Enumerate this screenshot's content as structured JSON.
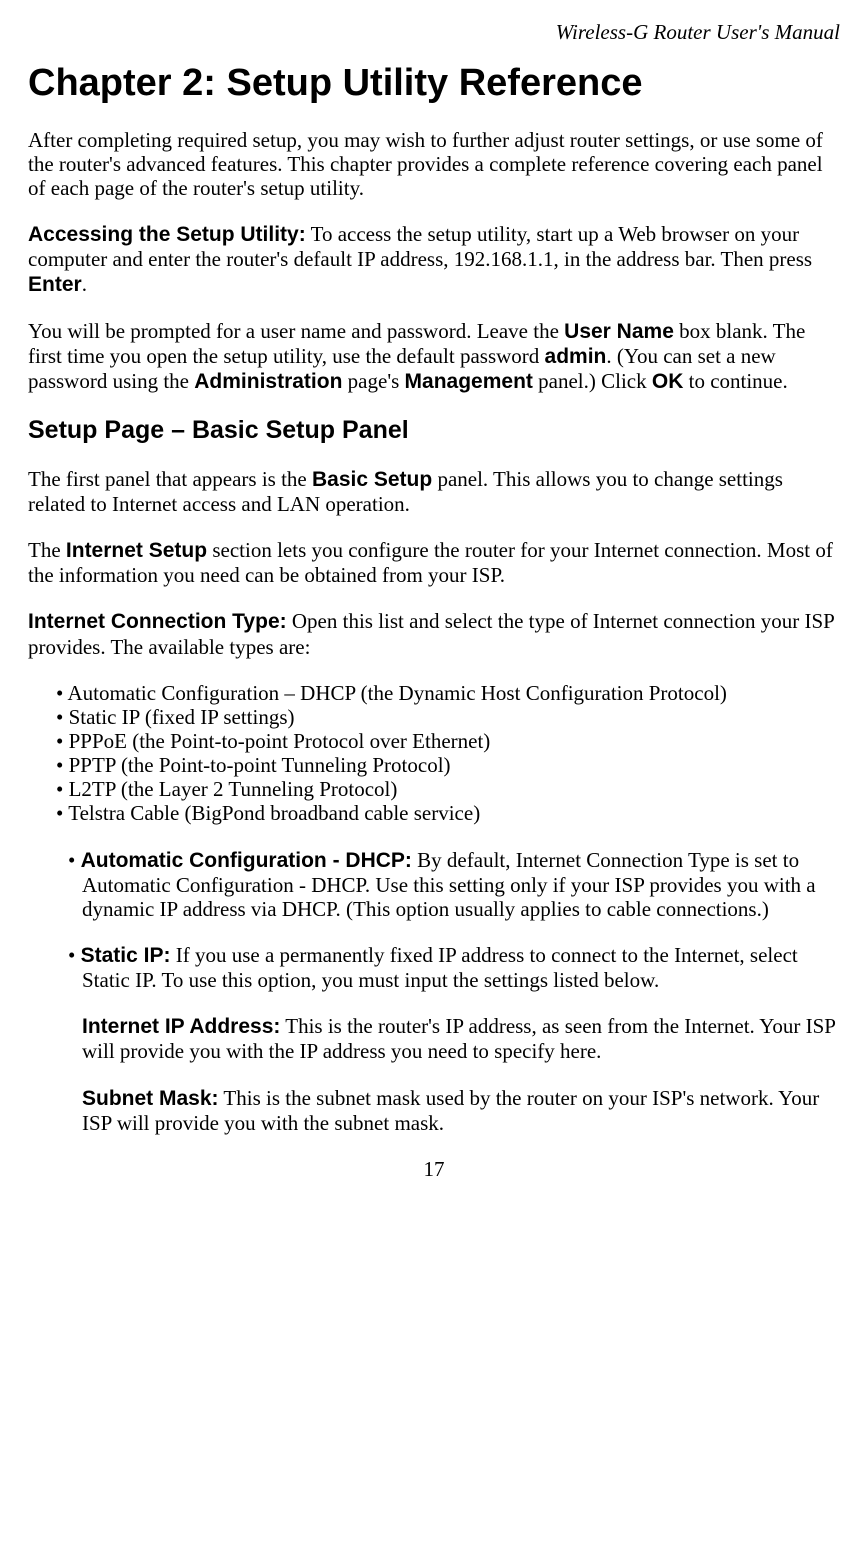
{
  "header": {
    "title": "Wireless-G Router User's Manual"
  },
  "chapter": {
    "title": "Chapter 2: Setup Utility Reference"
  },
  "intro": "After completing required setup, you may wish to further adjust router settings, or use some of the router's advanced features. This chapter provides a complete reference covering each panel of each page of the router's setup utility.",
  "accessing": {
    "label": "Accessing the Setup Utility:",
    "text1": " To access the setup utility, start up a Web browser on your computer and enter the router's default IP address, 192.168.1.1, in the address bar. Then press ",
    "enter": "Enter",
    "text2": "."
  },
  "login": {
    "text1": "You will be prompted for a user name and password. Leave the ",
    "username": "User Name",
    "text2": " box blank. The first time you open the setup utility, use the default password ",
    "admin": "admin",
    "text3": ". (You can set a new password using the ",
    "administration": "Administration",
    "text4": " page's ",
    "management": "Management",
    "text5": " panel.) Click ",
    "ok": "OK",
    "text6": " to continue."
  },
  "section": {
    "title": "Setup Page – Basic Setup Panel"
  },
  "basicsetup": {
    "text1": "The first panel that appears is the ",
    "label": "Basic Setup",
    "text2": " panel. This allows you to change settings related to Internet access and LAN operation."
  },
  "internetsetup": {
    "text1": "The ",
    "label": "Internet Setup",
    "text2": " section lets you configure the router for your Internet connection. Most of the information you need can be obtained from your ISP."
  },
  "conntype": {
    "label": "Internet Connection Type:",
    "text": " Open this list and select the type of Internet connection your ISP provides. The available types are:"
  },
  "types": [
    "• Automatic Configuration – DHCP (the Dynamic Host Configuration Protocol)",
    "• Static IP (fixed IP settings)",
    "• PPPoE (the Point-to-point Protocol over Ethernet)",
    "• PPTP (the Point-to-point Tunneling Protocol)",
    "• L2TP (the Layer 2 Tunneling Protocol)",
    "• Telstra Cable (BigPond broadband cable service)"
  ],
  "dhcp": {
    "bullet": "• ",
    "label": "Automatic Configuration - DHCP:",
    "text": " By default, Internet Connection Type is set to Automatic Configuration - DHCP. Use this setting only if your ISP provides you  with a dynamic IP address via DHCP. (This option usually applies to cable connections.)"
  },
  "staticip": {
    "bullet": "• ",
    "label": "Static IP:",
    "text": " If you use a permanently fixed IP address to connect to the Internet, select Static IP. To use this option, you must input the settings listed below."
  },
  "internetip": {
    "label": "Internet IP Address:",
    "text": " This is the router's IP address, as seen from the Internet. Your ISP will provide you with the IP address you need to specify here."
  },
  "subnet": {
    "label": "Subnet Mask:",
    "text": " This is the subnet mask used by the router on your ISP's network. Your ISP will provide you with the subnet mask."
  },
  "page": "17"
}
